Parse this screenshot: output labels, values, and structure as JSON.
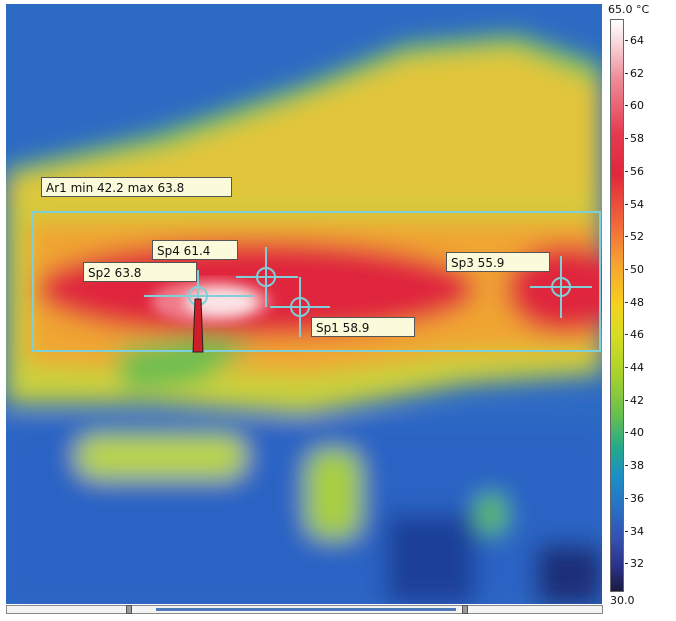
{
  "measurements": {
    "area": {
      "label": "Ar1 min 42.2 max 63.8"
    },
    "spots": [
      {
        "id": "sp1",
        "label": "Sp1 58.9"
      },
      {
        "id": "sp2",
        "label": "Sp2 63.8"
      },
      {
        "id": "sp3",
        "label": "Sp3 55.9"
      },
      {
        "id": "sp4",
        "label": "Sp4 61.4"
      }
    ]
  },
  "scale": {
    "max_label": "65.0 °C",
    "min_label": "30.0",
    "ticks": [
      "64",
      "62",
      "60",
      "58",
      "56",
      "54",
      "52",
      "50",
      "48",
      "46",
      "44",
      "42",
      "40",
      "38",
      "36",
      "34",
      "32"
    ]
  },
  "colors": {
    "hot": "#e0283c",
    "warm": "#f5d11c",
    "cool": "#2a6dc4",
    "marker": "#7fcfd8"
  }
}
